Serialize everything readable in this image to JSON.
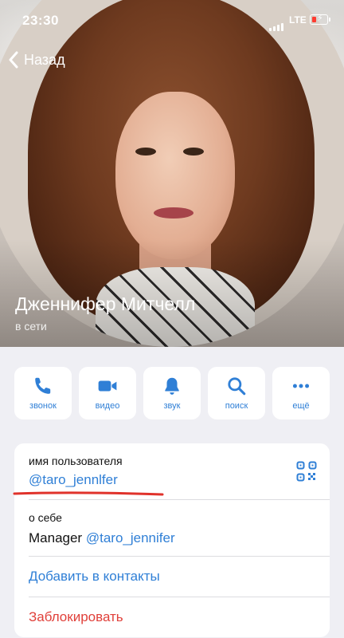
{
  "status_bar": {
    "time": "23:30",
    "network": "LTE"
  },
  "nav": {
    "back_label": "Назад"
  },
  "profile": {
    "name": "Дженнифер Митчелл",
    "presence": "в сети"
  },
  "actions": [
    {
      "label": "звонок",
      "icon": "phone-icon"
    },
    {
      "label": "видео",
      "icon": "video-icon"
    },
    {
      "label": "звук",
      "icon": "bell-icon"
    },
    {
      "label": "поиск",
      "icon": "search-icon"
    },
    {
      "label": "ещё",
      "icon": "more-icon"
    }
  ],
  "info": {
    "username_caption": "имя пользователя",
    "username": "@taro_jennlfer",
    "about_caption": "о себе",
    "about_text": "Manager",
    "about_mention": "@taro_jennifer",
    "add_contact": "Добавить в контакты",
    "block": "Заблокировать"
  },
  "colors": {
    "accent": "#2f7fd6",
    "danger": "#e0403a",
    "annotation": "#e0322b",
    "background": "#efeff4"
  }
}
